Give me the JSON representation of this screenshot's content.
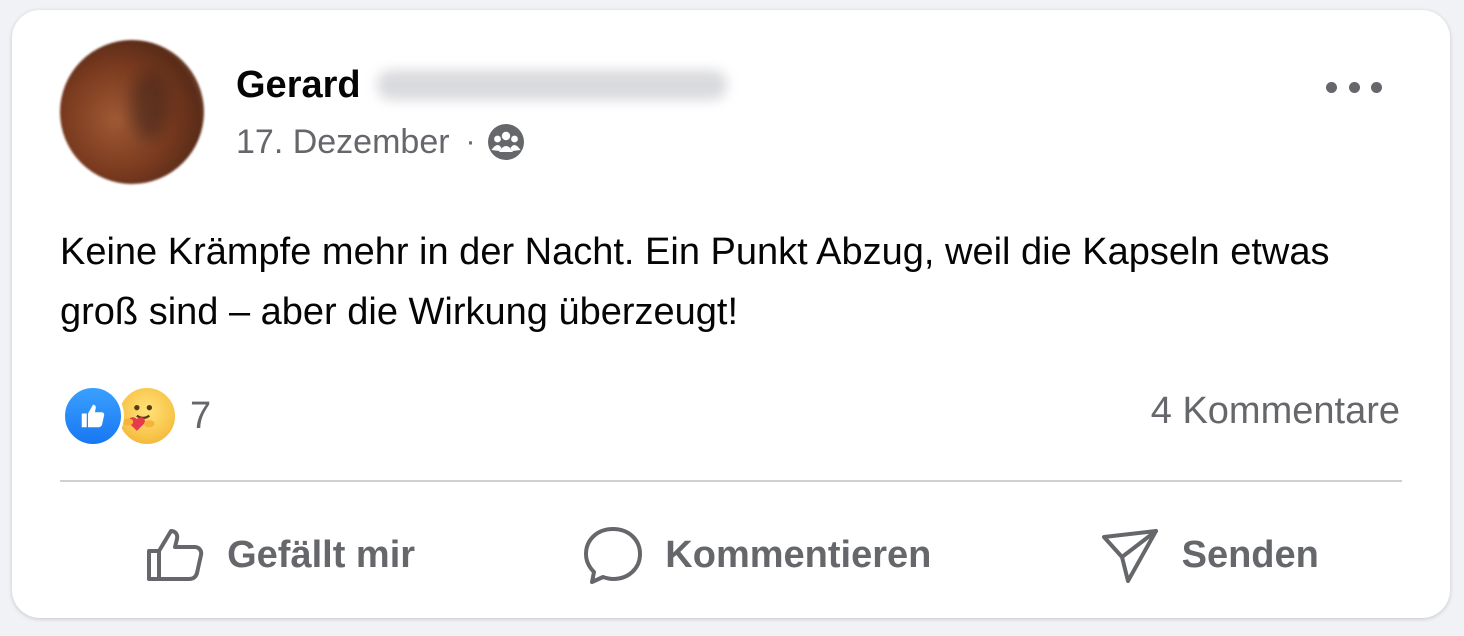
{
  "post": {
    "author_name": "Gerard",
    "date": "17. Dezember",
    "meta_separator": "·",
    "audience_icon": "friends-group-icon",
    "text": "Keine Krämpfe mehr in der Nacht. Ein Punkt Abzug, weil die Kapseln etwas groß sind – aber die Wirkung überzeugt!",
    "more_icon": "more-horizontal-icon"
  },
  "stats": {
    "reactions": [
      "like-reaction-icon",
      "care-reaction-icon"
    ],
    "reaction_count": "7",
    "comments_label": "4 Kommentare"
  },
  "actions": {
    "like_label": "Gefällt mir",
    "comment_label": "Kommentieren",
    "share_label": "Senden"
  },
  "colors": {
    "text_primary": "#050505",
    "text_secondary": "#65676b",
    "like_blue": "#1877f2",
    "divider": "#ced0d4",
    "card_bg": "#ffffff"
  }
}
